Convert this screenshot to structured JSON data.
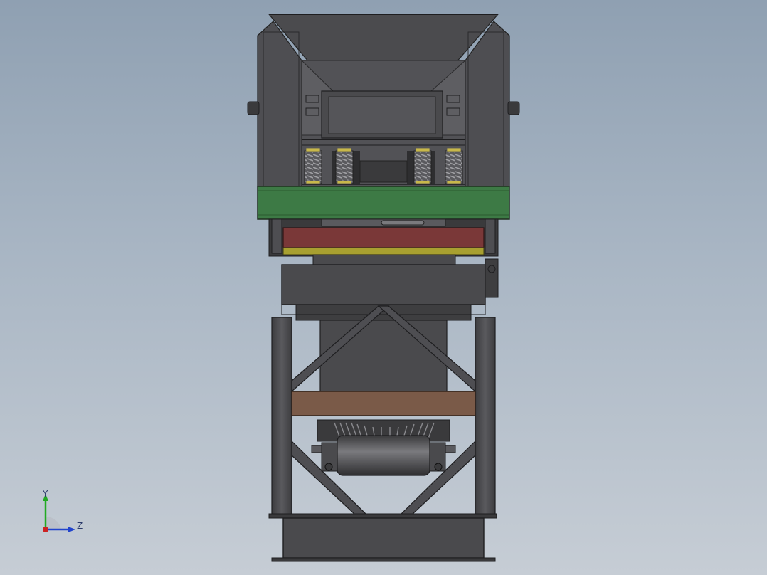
{
  "viewport": {
    "background_top": "#8fa0b2",
    "background_bottom": "#c6cdd5"
  },
  "model": {
    "colors": {
      "steel": "#4a4a4d",
      "steel_dark": "#2e2e30",
      "steel_light": "#6a6a6e",
      "green_frame": "#3d7a45",
      "red_plate": "#7a3838",
      "yellow_plate": "#a8a030",
      "brown_beam": "#7a5a48",
      "spring": "#8a8a8a",
      "spring_cap": "#c8b84a"
    }
  },
  "triad": {
    "y_label": "Y",
    "z_label": "Z",
    "y_color": "#22aa22",
    "z_color": "#2244cc",
    "x_color": "#cc2222"
  }
}
